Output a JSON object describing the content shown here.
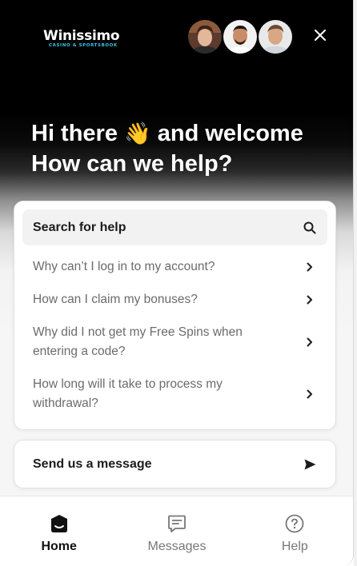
{
  "brand": {
    "name": "Winissimo",
    "tagline": "CASINO & SPORTSBOOK",
    "accent_color": "#35c6ea"
  },
  "header": {
    "avatars": [
      {
        "icon": "agent-avatar-1"
      },
      {
        "icon": "agent-avatar-2"
      },
      {
        "icon": "agent-avatar-3"
      }
    ],
    "close_icon": "close-icon"
  },
  "greeting": {
    "line1_before_emoji": "Hi there",
    "emoji": "👋",
    "line1_after_emoji": "and welcome",
    "line2": "How can we help?"
  },
  "search": {
    "label": "Search for help",
    "icon": "search-icon"
  },
  "faqs": [
    {
      "text": "Why can’t I log in to my account?"
    },
    {
      "text": "How can I claim my bonuses?"
    },
    {
      "text": "Why did I not get my Free Spins when entering a code?"
    },
    {
      "text": "How long will it take to process my withdrawal?"
    }
  ],
  "message": {
    "label": "Send us a message",
    "icon": "send-icon"
  },
  "tabs": [
    {
      "label": "Home",
      "icon": "home-icon",
      "active": true
    },
    {
      "label": "Messages",
      "icon": "messages-icon",
      "active": false
    },
    {
      "label": "Help",
      "icon": "help-icon",
      "active": false
    }
  ]
}
